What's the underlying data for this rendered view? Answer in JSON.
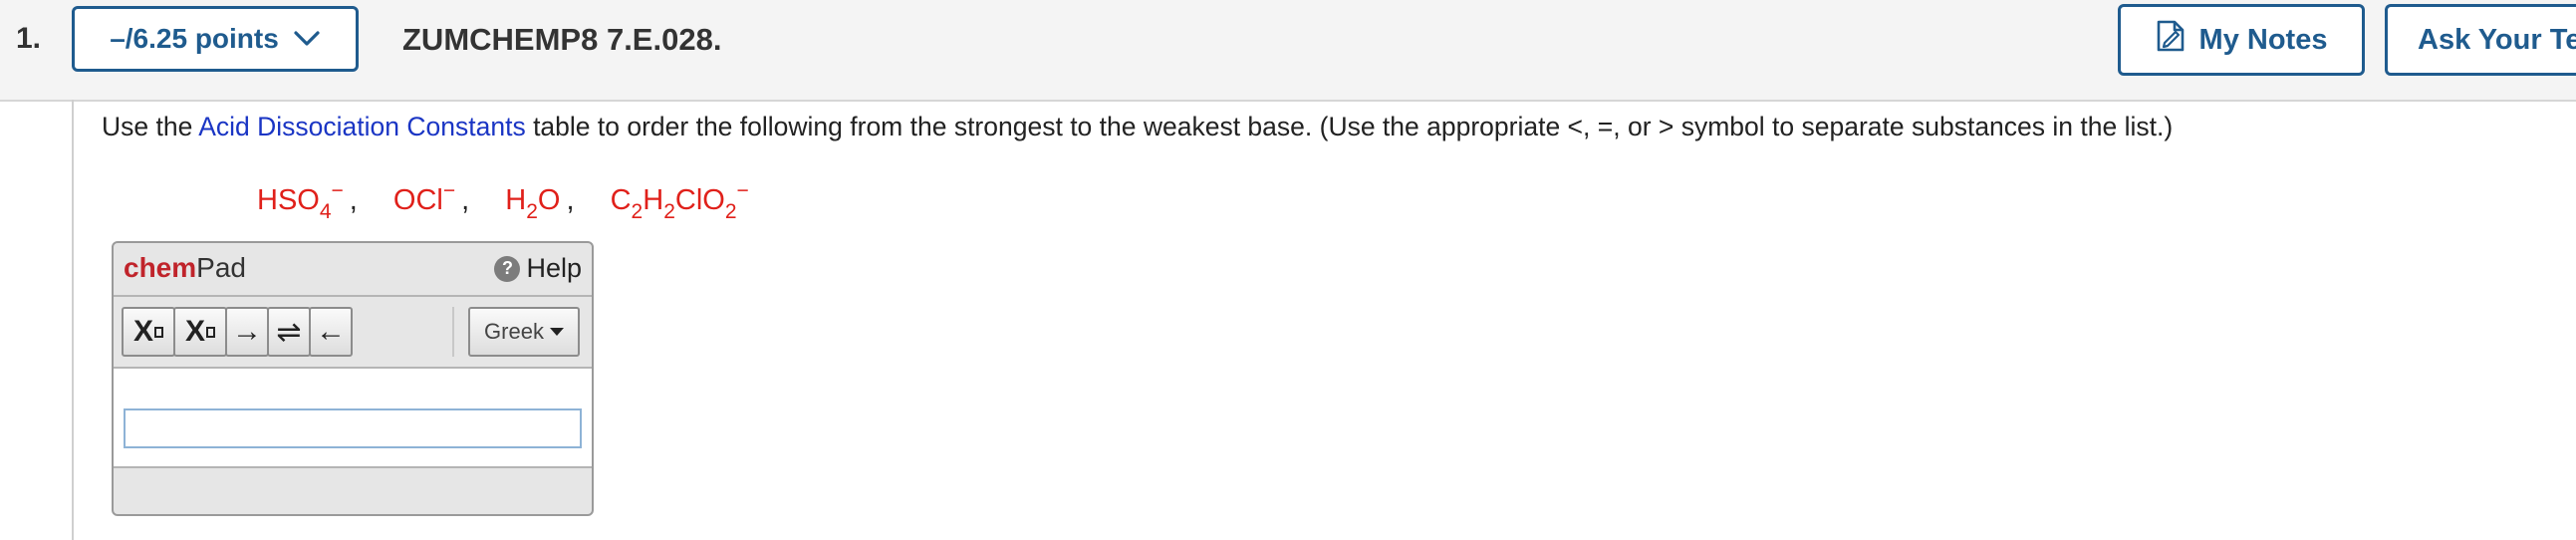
{
  "question": {
    "number": "1.",
    "points": "–/6.25 points",
    "id": "ZUMCHEMP8 7.E.028."
  },
  "header_buttons": {
    "my_notes": "My Notes",
    "ask": "Ask Your Te"
  },
  "prompt": {
    "before_link": "Use the ",
    "link": "Acid Dissociation Constants",
    "after_link": " table to order the following from the strongest to the weakest base. (Use the appropriate <, =, or > symbol to separate substances in the list.)"
  },
  "species": [
    {
      "parts": [
        "HSO",
        "4",
        "−"
      ]
    },
    {
      "parts": [
        "OCl",
        "",
        "−"
      ]
    },
    {
      "parts": [
        "H",
        "2",
        "O"
      ]
    },
    {
      "parts": [
        "C",
        "2",
        "H",
        "2",
        "ClO",
        "2",
        "−"
      ]
    }
  ],
  "species_separator": ",",
  "chempad": {
    "logo_bold": "chem",
    "logo_rest": "Pad",
    "help_label": "Help",
    "help_glyph": "?",
    "tools": {
      "subscript_label": "X",
      "superscript_label": "X",
      "arrow_right": "→",
      "arrow_equilibrium": "⇌",
      "arrow_left": "←"
    },
    "greek_label": "Greek",
    "input_value": ""
  },
  "colors": {
    "accent": "#1f5b8e",
    "link": "#1a35c4",
    "species": "#e0201a",
    "chempad_brand": "#c0242b"
  }
}
